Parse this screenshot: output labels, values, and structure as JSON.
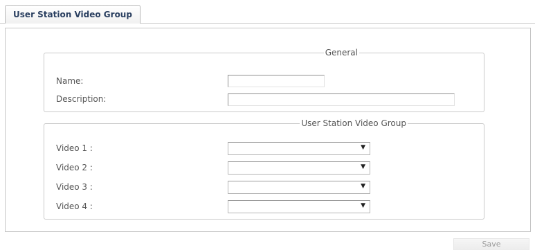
{
  "tabs": [
    {
      "label": "User Station Video Group",
      "active": true
    }
  ],
  "general": {
    "legend": "General",
    "name_label": "Name:",
    "name_value": "",
    "description_label": "Description:",
    "description_value": ""
  },
  "video_group": {
    "legend": "User Station Video Group",
    "rows": [
      {
        "label": "Video 1 :",
        "selected": ""
      },
      {
        "label": "Video 2 :",
        "selected": ""
      },
      {
        "label": "Video 3 :",
        "selected": ""
      },
      {
        "label": "Video 4 :",
        "selected": ""
      }
    ],
    "dropdown_icon": "chevron-down-icon"
  },
  "actions": {
    "save_label": "Save"
  }
}
